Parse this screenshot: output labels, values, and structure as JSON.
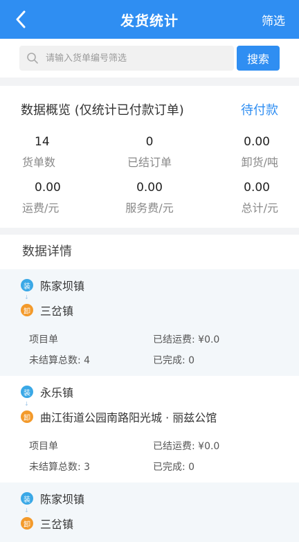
{
  "header": {
    "title": "发货统计",
    "filter_label": "筛选"
  },
  "search": {
    "placeholder": "请输入货单编号筛选",
    "button_label": "搜索"
  },
  "overview": {
    "title": "数据概览 (仅统计已付款订单)",
    "pending_label": "待付款",
    "stats": [
      {
        "value": "14",
        "label": "货单数"
      },
      {
        "value": "0",
        "label": "已结订单"
      },
      {
        "value": "0.00",
        "label": "卸货/吨"
      },
      {
        "value": "0.00",
        "label": "运费/元"
      },
      {
        "value": "0.00",
        "label": "服务费/元"
      },
      {
        "value": "0.00",
        "label": "总计/元"
      }
    ]
  },
  "details": {
    "title": "数据详情",
    "load_badge": "装",
    "unload_badge": "卸",
    "cards": [
      {
        "from": "陈家坝镇",
        "to": "三岔镇",
        "project": "项目单",
        "freight_settled": "已结运费: ¥0.0",
        "unsettled": "未结算总数: 4",
        "completed": "已完成: 0"
      },
      {
        "from": "永乐镇",
        "to": "曲江街道公园南路阳光城 · 丽兹公馆",
        "project": "项目单",
        "freight_settled": "已结运费: ¥0.0",
        "unsettled": "未结算总数: 3",
        "completed": "已完成: 0"
      },
      {
        "from": "陈家坝镇",
        "to": "三岔镇"
      }
    ]
  }
}
